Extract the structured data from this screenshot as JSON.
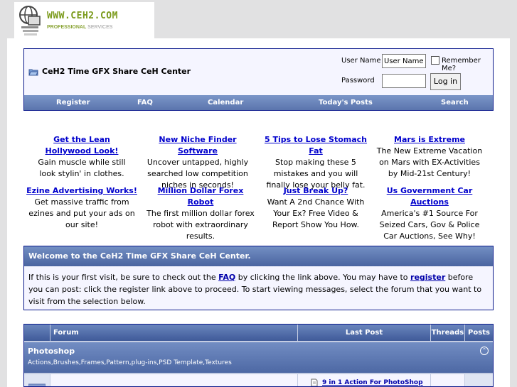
{
  "logo": {
    "main": "WWW.CEH2.COM",
    "sub_bold": "PROFESSIONAL",
    "sub_light": " SERVICES",
    "icon": "globe-computer-icon"
  },
  "breadcrumb": {
    "title": "CeH2 Time GFX Share CeH Center",
    "icon": "folder-icon"
  },
  "login": {
    "username_label": "User Name",
    "username_value": "User Name",
    "remember_label": "Remember Me?",
    "password_label": "Password",
    "password_value": "",
    "button": "Log in"
  },
  "navbar": [
    "Register",
    "FAQ",
    "Calendar",
    "Today's Posts",
    "Search"
  ],
  "ads": [
    {
      "title": "Get the Lean Hollywood Look!",
      "text": "Gain muscle while still look stylin' in clothes."
    },
    {
      "title": "New Niche Finder Software ",
      "text": "Uncover untapped, highly searched low competition niches in seconds!"
    },
    {
      "title": "5 Tips to Lose Stomach Fat ",
      "text": "Stop making these 5 mistakes and you will finally lose your belly fat."
    },
    {
      "title": "Mars is Extreme ",
      "text": "The New Extreme Vacation on Mars with EX-Activities by Mid-21st Century!"
    },
    {
      "title": "Ezine Advertising Works! ",
      "text": "Get massive traffic from ezines and put your ads on our site!"
    },
    {
      "title": "Million Dollar Forex Robot ",
      "text": "The first million dollar forex robot with extraordinary results."
    },
    {
      "title": "Just Break Up? ",
      "text": "Want A 2nd Chance With Your Ex? Free Video & Report Show You How."
    },
    {
      "title": "Us Government Car Auctions ",
      "text": "America's #1 Source For Seized Cars, Gov & Police Car Auctions, See Why!"
    }
  ],
  "welcome": {
    "title": "Welcome to the CeH2 Time GFX Share CeH Center.",
    "text1": "If this is your first visit, be sure to check out the ",
    "faq_link": "FAQ",
    "text2": " by clicking the link above. You may have to ",
    "register_link": "register",
    "text3": " before you can post: click the register link above to proceed. To start viewing messages, select the forum that you want to visit from the selection below."
  },
  "forum_table": {
    "headers": [
      "Forum",
      "Last Post",
      "Threads",
      "Posts"
    ],
    "category": {
      "title": "Photoshop",
      "description": "Actions,Brushes,Frames,Pattern,plug-ins,PSD Template,Textures"
    },
    "last_post_title": "9 in 1 Action For PhotoShop"
  }
}
